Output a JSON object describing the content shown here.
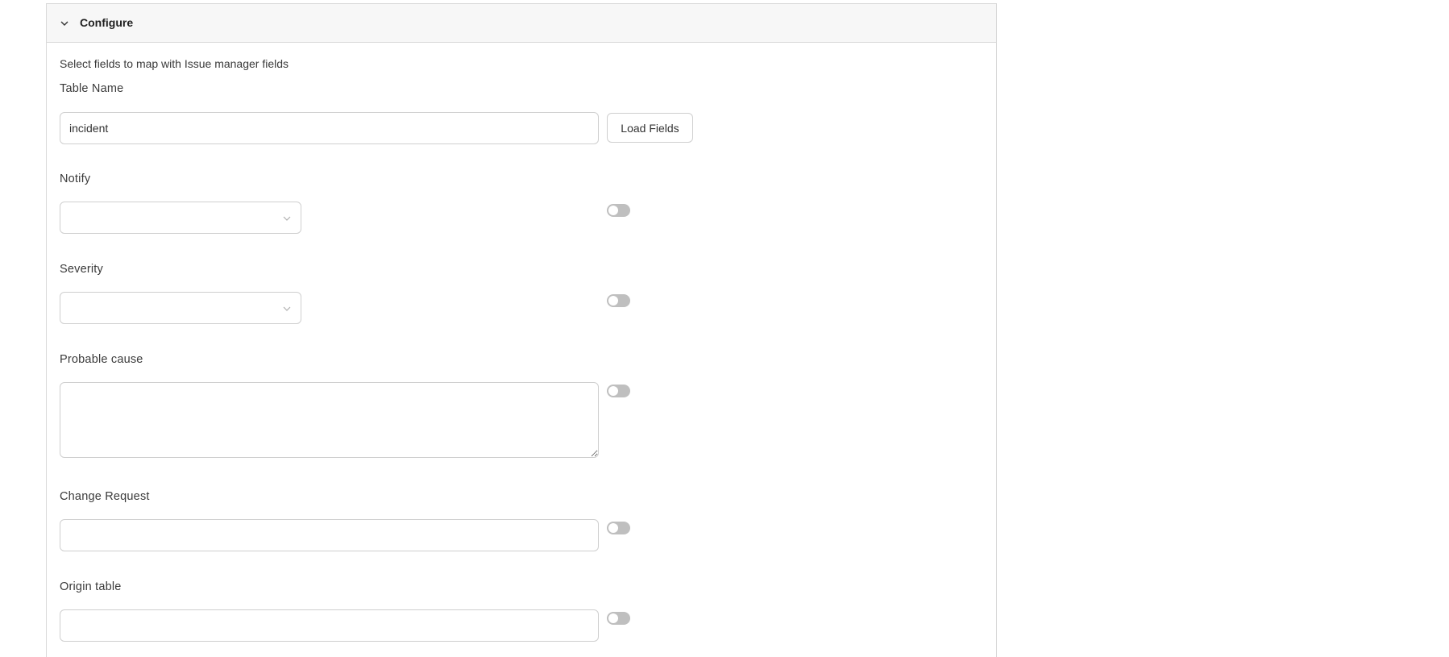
{
  "section": {
    "title": "Configure",
    "description": "Select fields to map with Issue manager fields"
  },
  "table_name": {
    "label": "Table Name",
    "value": "incident",
    "load_button": "Load Fields"
  },
  "fields": {
    "notify": {
      "label": "Notify",
      "value": "",
      "enabled": false
    },
    "severity": {
      "label": "Severity",
      "value": "",
      "enabled": false
    },
    "probable_cause": {
      "label": "Probable cause",
      "value": "",
      "enabled": false
    },
    "change_request": {
      "label": "Change Request",
      "value": "",
      "enabled": false
    },
    "origin_table": {
      "label": "Origin table",
      "value": "",
      "enabled": false
    }
  },
  "icons": {
    "header_chevron": "chevron-down-icon",
    "select_caret": "chevron-down-icon"
  },
  "colors": {
    "header_bg": "#f7f7f7",
    "border": "#d9d9d9",
    "toggle_off": "#bfbfbf"
  }
}
